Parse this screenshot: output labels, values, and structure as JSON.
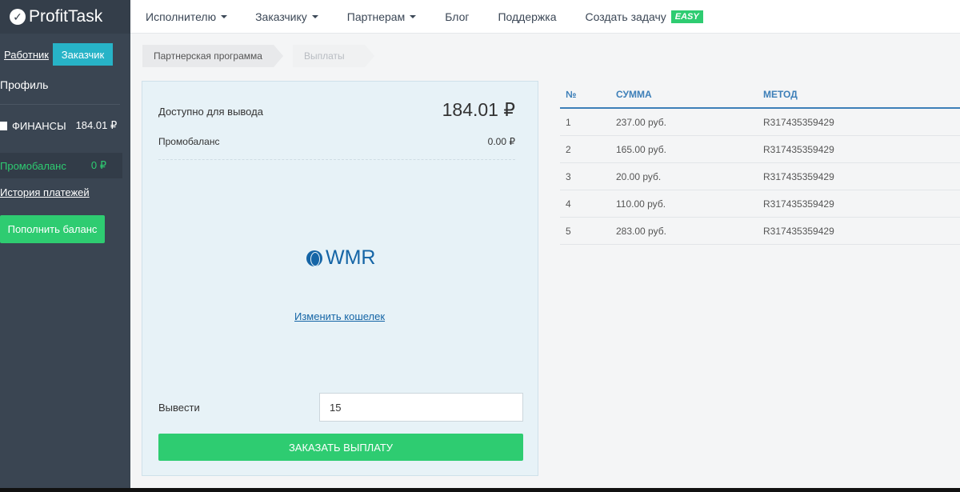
{
  "brand": {
    "name": "ProfitTask"
  },
  "sidebar": {
    "role_worker": "Работник",
    "role_customer": "Заказчик",
    "profile": "Профиль",
    "finance_label": "ФИНАНСЫ",
    "finance_amount": "184.01 ₽",
    "promo_label": "Промобаланс",
    "promo_value": "0 ₽",
    "history": "История платежей",
    "topup": "Пополнить баланс"
  },
  "nav": {
    "items": [
      "Исполнителю",
      "Заказчику",
      "Партнерам",
      "Блог",
      "Поддержка",
      "Создать задачу"
    ],
    "badge": "EASY"
  },
  "breadcrumb": [
    "Партнерская программа",
    "Выплаты"
  ],
  "card": {
    "available_label": "Доступно для вывода",
    "available_value": "184.01 ₽",
    "promo_label": "Промобаланс",
    "promo_value": "0.00 ₽",
    "wallet": "WMR",
    "change_wallet": "Изменить кошелек",
    "withdraw_label": "Вывести",
    "withdraw_value": "15",
    "submit": "ЗАКАЗАТЬ ВЫПЛАТУ"
  },
  "table": {
    "headers": [
      "№",
      "СУММА",
      "МЕТОД"
    ],
    "rows": [
      [
        "1",
        "237.00 руб.",
        "R317435359429"
      ],
      [
        "2",
        "165.00 руб.",
        "R317435359429"
      ],
      [
        "3",
        "20.00 руб.",
        "R317435359429"
      ],
      [
        "4",
        "110.00 руб.",
        "R317435359429"
      ],
      [
        "5",
        "283.00 руб.",
        "R317435359429"
      ]
    ]
  },
  "colors": {
    "sidebar": "#3a4552",
    "accent_green": "#2ecc71",
    "accent_teal": "#27b3c7",
    "link_blue": "#1565a6",
    "header_blue": "#3d7fb8"
  }
}
